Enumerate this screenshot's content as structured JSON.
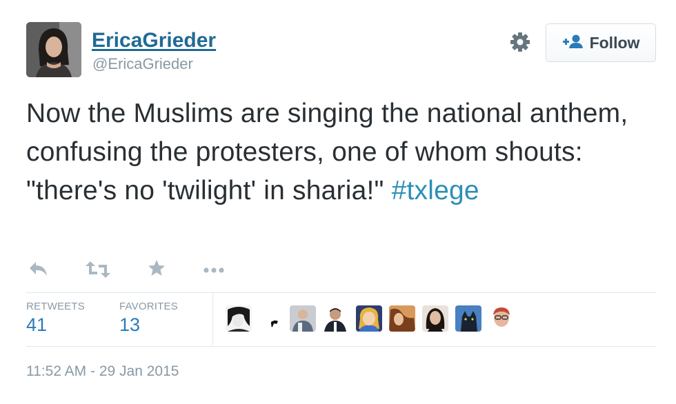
{
  "user": {
    "display_name": "EricaGrieder",
    "handle": "@EricaGrieder"
  },
  "header": {
    "follow_label": "Follow"
  },
  "tweet": {
    "text_before": "Now the Muslims are singing the national anthem, confusing the protesters, one of whom shouts: \"there's no 'twilight' in sharia!\" ",
    "hashtag": "#txlege"
  },
  "stats": {
    "retweets_label": "RETWEETS",
    "retweets_value": "41",
    "favorites_label": "FAVORITES",
    "favorites_value": "13"
  },
  "favoriters": [
    {
      "icon": "avatar-1"
    },
    {
      "icon": "avatar-2"
    },
    {
      "icon": "avatar-3"
    },
    {
      "icon": "avatar-4"
    },
    {
      "icon": "avatar-5"
    },
    {
      "icon": "avatar-6"
    },
    {
      "icon": "avatar-7"
    },
    {
      "icon": "avatar-8"
    },
    {
      "icon": "avatar-9"
    }
  ],
  "timestamp": "11:52 AM - 29 Jan 2015",
  "colors": {
    "link": "#1f6a95",
    "hashtag": "#2b8fb5",
    "muted": "#8899a6",
    "stat_value": "#2b7bb9"
  }
}
